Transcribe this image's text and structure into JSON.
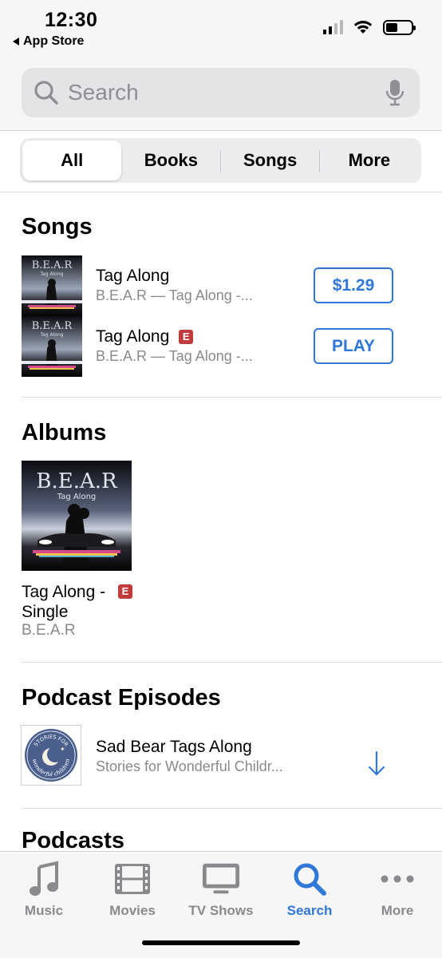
{
  "status_bar": {
    "time": "12:30",
    "back_label": "App Store",
    "battery_level": 0.46
  },
  "search": {
    "placeholder": "Search"
  },
  "segments": [
    "All",
    "Books",
    "Songs",
    "More"
  ],
  "songs_section": {
    "title": "Songs",
    "items": [
      {
        "title": "Tag Along",
        "subtitle": "B.E.A.R — Tag Along -...",
        "explicit": false,
        "action": "$1.29"
      },
      {
        "title": "Tag Along",
        "subtitle": "B.E.A.R — Tag Along -...",
        "explicit": true,
        "action": "PLAY"
      }
    ]
  },
  "albums_section": {
    "title": "Albums",
    "album": {
      "title": "Tag Along - Single",
      "artist": "B.E.A.R",
      "explicit_badge": "E"
    },
    "art_text": {
      "band": "B.E.A.R",
      "song": "Tag Along"
    }
  },
  "podcast_episodes_section": {
    "title": "Podcast Episodes",
    "episode": {
      "title": "Sad Bear Tags Along",
      "subtitle": "Stories for Wonderful Childr..."
    },
    "art_text": {
      "top": "STORIES FOR",
      "bottom": "wonderful children"
    }
  },
  "podcasts_section": {
    "title": "Podcasts"
  },
  "explicit_badge": "E",
  "tab_bar": {
    "tabs": [
      {
        "label": "Music",
        "icon": "music-note-icon"
      },
      {
        "label": "Movies",
        "icon": "film-icon"
      },
      {
        "label": "TV Shows",
        "icon": "tv-icon"
      },
      {
        "label": "Search",
        "icon": "search-icon"
      },
      {
        "label": "More",
        "icon": "more-icon"
      }
    ],
    "active": "Search"
  },
  "colors": {
    "accent": "#2f77d8",
    "explicit": "#c13b3b",
    "secondary_text": "#8a8a8e"
  }
}
